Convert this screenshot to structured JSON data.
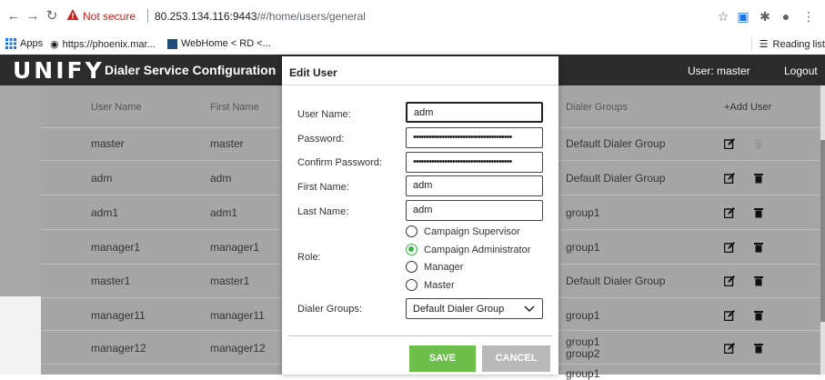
{
  "browser": {
    "not_secure": "Not secure",
    "url_host": "80.253.134.116:9443",
    "url_path": "/#/home/users/general",
    "bookmarks": [
      "Apps",
      "https://phoenix.mar...",
      "WebHome < RD <..."
    ],
    "reading_list": "Reading list"
  },
  "header": {
    "logo": "UNIFY",
    "title": "Dialer Service Configuration",
    "user": "User: master",
    "logout": "Logout"
  },
  "table": {
    "columns": [
      "User Name",
      "First Name",
      "Dialer Groups",
      "+Add User"
    ],
    "rows": [
      {
        "user": "master",
        "first": "master",
        "groups": "Default Dialer Group"
      },
      {
        "user": "adm",
        "first": "adm",
        "groups": "Default Dialer Group"
      },
      {
        "user": "adm1",
        "first": "adm1",
        "groups": "group1"
      },
      {
        "user": "manager1",
        "first": "manager1",
        "groups": "group1"
      },
      {
        "user": "master1",
        "first": "master1",
        "groups": "Default Dialer Group"
      },
      {
        "user": "manager11",
        "first": "manager11",
        "groups": "group1"
      },
      {
        "user": "manager12",
        "first": "manager12",
        "groups": "group1",
        "groups2": "group2"
      },
      {
        "groups": "group1"
      }
    ]
  },
  "modal": {
    "title": "Edit User",
    "labels": {
      "username": "User Name:",
      "password": "Password:",
      "confirm": "Confirm Password:",
      "first": "First Name:",
      "last": "Last Name:",
      "role": "Role:",
      "groups": "Dialer Groups:"
    },
    "values": {
      "username": "adm",
      "password": "••••••••••••••••••••••••••••••••••••••",
      "confirm": "••••••••••••••••••••••••••••••••••••••",
      "first": "adm",
      "last": "adm",
      "group": "Default Dialer Group"
    },
    "roles": [
      "Campaign Supervisor",
      "Campaign Administrator",
      "Manager",
      "Master"
    ],
    "selected_role": "Campaign Administrator",
    "save": "SAVE",
    "cancel": "CANCEL"
  },
  "colors": {
    "accent": "#6bbf4a",
    "header": "#2b2b2b",
    "warning": "#c5221f"
  }
}
